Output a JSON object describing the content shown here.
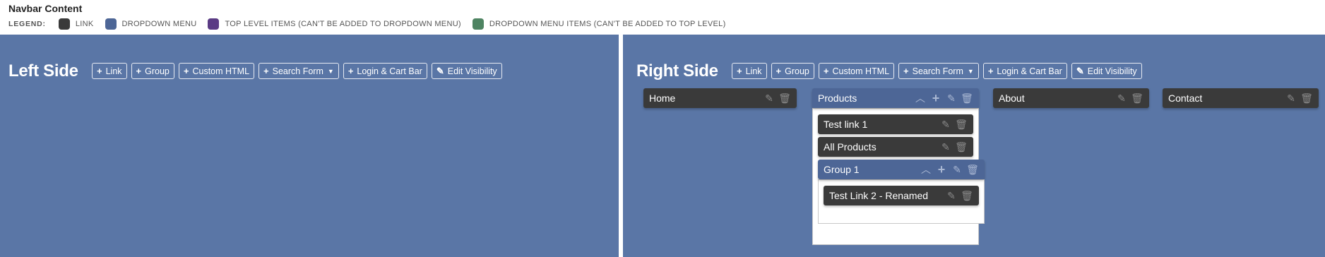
{
  "header": {
    "title": "Navbar Content",
    "legend_label": "LEGEND:",
    "legend": [
      {
        "label": "Link",
        "color": "#3a3a3a"
      },
      {
        "label": "Dropdown Menu",
        "color": "#4d6696"
      },
      {
        "label": "Top Level Items (Can't be added to dropdown menu)",
        "color": "#5a3b84"
      },
      {
        "label": "Dropdown Menu Items (Can't be added to top level)",
        "color": "#4e8462"
      }
    ]
  },
  "toolbar": {
    "link": "Link",
    "group": "Group",
    "custom_html": "Custom HTML",
    "search_form": "Search Form",
    "login_cart": "Login & Cart Bar",
    "edit_visibility": "Edit Visibility"
  },
  "left": {
    "title": "Left Side"
  },
  "right": {
    "title": "Right Side",
    "items": {
      "home": "Home",
      "products": "Products",
      "test_link_1": "Test link 1",
      "all_products": "All Products",
      "group_1": "Group 1",
      "test_link_2": "Test Link 2 - Renamed",
      "about": "About",
      "contact": "Contact"
    }
  },
  "colors": {
    "panel_bg": "#5a76a6",
    "link_bg": "#3a3a3a",
    "dropdown_bg": "#4d6696"
  }
}
